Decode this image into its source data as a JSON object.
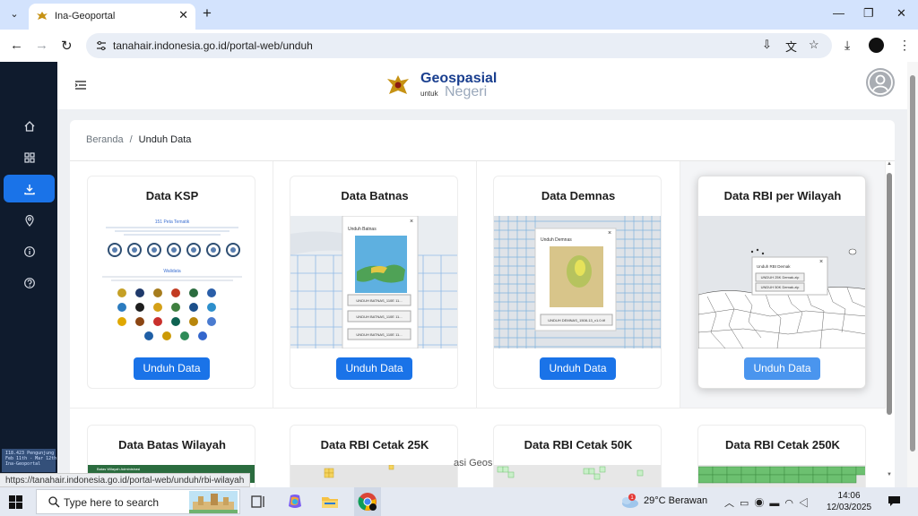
{
  "browser": {
    "tab_title": "Ina-Geoportal",
    "tab_close": "✕",
    "new_tab": "+",
    "url": "tanahair.indonesia.go.id/portal-web/unduh",
    "window_controls": [
      "—",
      "❐",
      "✕"
    ]
  },
  "header": {
    "logo_top": "Geospasial",
    "logo_small": "untuk",
    "logo_bottom": "Negeri"
  },
  "sidebar": {
    "items": [
      {
        "icon": "home-icon",
        "active": false
      },
      {
        "icon": "grid-icon",
        "active": false
      },
      {
        "icon": "download-icon",
        "active": true
      },
      {
        "icon": "location-pin-icon",
        "active": false
      },
      {
        "icon": "info-icon",
        "active": false
      },
      {
        "icon": "help-icon",
        "active": false
      }
    ],
    "thumb_text": "I18.423 Pengunjung\nFeb 11th - Mar 12th\nIna-Geoportal"
  },
  "breadcrumb": {
    "home": "Beranda",
    "separator": "/",
    "current": "Unduh Data"
  },
  "cards": [
    {
      "title": "Data KSP",
      "button": "Unduh Data"
    },
    {
      "title": "Data Batnas",
      "button": "Unduh Data"
    },
    {
      "title": "Data Demnas",
      "button": "Unduh Data"
    },
    {
      "title": "Data RBI per Wilayah",
      "button": "Unduh Data"
    },
    {
      "title": "Data Batas Wilayah"
    },
    {
      "title": "Data RBI Cetak 25K"
    },
    {
      "title": "Data RBI Cetak 50K"
    },
    {
      "title": "Data RBI Cetak 250K"
    }
  ],
  "ksp_preview": {
    "title": "151 Peta Tematik",
    "subtitle": "Walidata"
  },
  "batnas_popup": {
    "title": "Unduh Batnas",
    "items": [
      "UNDUH BATNAS_110E 11...",
      "UNDUH BATNAS_110E 11...",
      "UNDUH BATNAS_110E 11..."
    ]
  },
  "demnas_popup": {
    "title": "Unduh Demnas",
    "item": "UNDUH DEMNAS_1508-13_v1.0.tif"
  },
  "rbi_popup": {
    "title": "Unduh RBI Demak",
    "items": [
      "UNDUH 25K Demak.zip",
      "UNDUH 50K Demak.zip"
    ]
  },
  "batas_preview_title": "Batas Wilayah Administrasi",
  "status_url": "https://tanahair.indonesia.go.id/portal-web/unduh/rbi-wilayah",
  "background_text": "asi Geos",
  "taskbar": {
    "search_placeholder": "Type here to search",
    "weather_temp": "29°C",
    "weather_desc": "Berawan",
    "weather_badge": "1",
    "time": "14:06",
    "date": "12/03/2025"
  },
  "colors": {
    "accent": "#1a73e8",
    "sidebar": "#0f1b2d",
    "chrome_tabstrip": "#d3e3fd"
  }
}
